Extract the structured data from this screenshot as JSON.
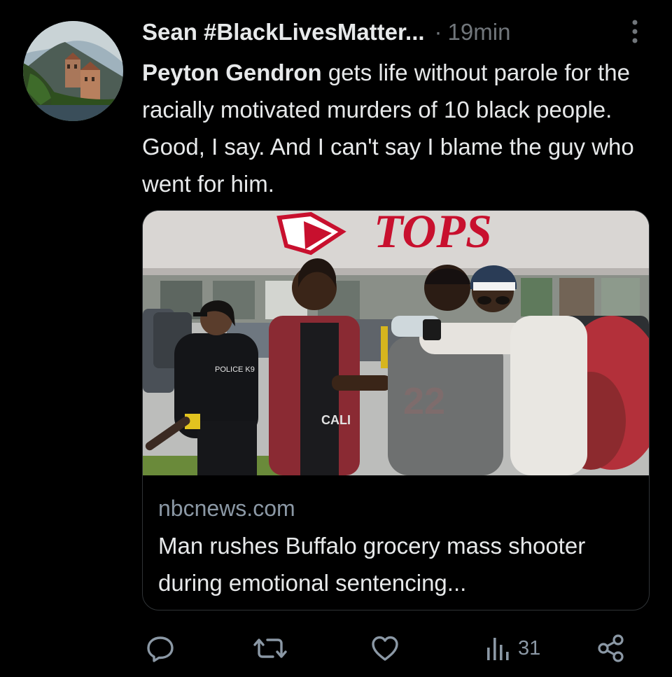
{
  "tweet": {
    "author": {
      "display_name": "Sean #BlackLivesMatter...",
      "avatar_icon": "avatar-lakeside-villa"
    },
    "separator": "·",
    "time": "19min",
    "more_icon": "vertical-dots-icon",
    "text": {
      "mention": "Peyton Gendron",
      "body": " gets life without parole for the racially motivated murders of 10 black people. Good, I say. And I can't say I blame the guy who went for him."
    },
    "card": {
      "image_sign": "TOPS",
      "image_shirt_badge": "POLICE K9",
      "image_shirt_text": "CALI",
      "domain": "nbcnews.com",
      "title": "Man rushes Buffalo grocery mass shooter during emotional sentencing..."
    },
    "actions": {
      "reply_icon": "reply-icon",
      "retweet_icon": "retweet-icon",
      "like_icon": "like-icon",
      "views_icon": "views-icon",
      "views_count": "31",
      "share_icon": "share-icon"
    }
  },
  "colors": {
    "background": "#000000",
    "text_primary": "#e7e9ea",
    "text_secondary": "#71767b",
    "border": "#2f3336"
  }
}
